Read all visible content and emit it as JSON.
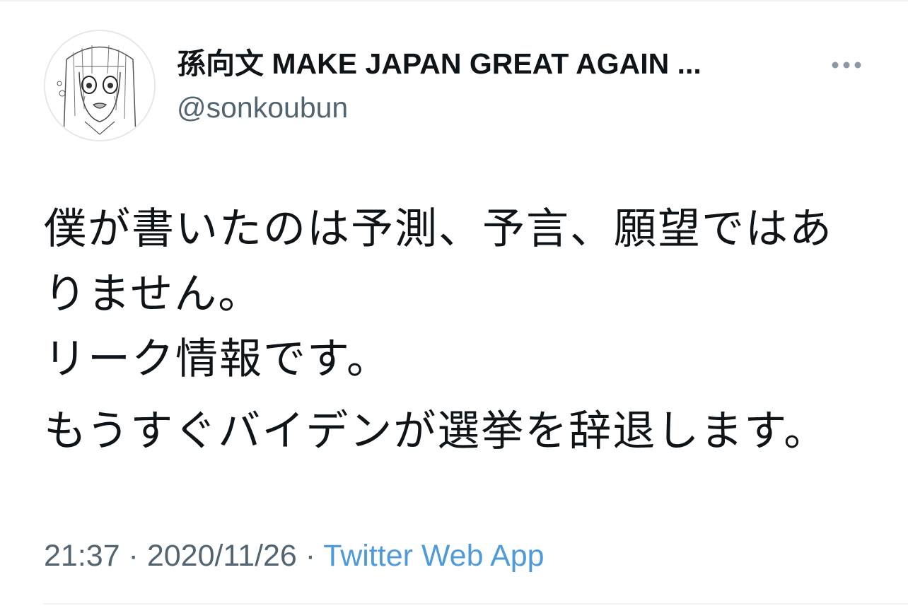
{
  "tweet": {
    "author": {
      "display_name": "孫向文  MAKE JAPAN GREAT AGAIN ...",
      "handle": "@sonkoubun"
    },
    "text": {
      "line1": "僕が書いたのは予測、予言、願望ではあ",
      "line2": "りません。",
      "line3": "リーク情報です。",
      "line4": "もうすぐバイデンが選挙を辞退します。"
    },
    "meta": {
      "time": "21:37",
      "separator": " · ",
      "date": "2020/11/26",
      "source": "Twitter Web App"
    }
  },
  "icons": {
    "avatar": "avatar-illustration",
    "more": "more-dots-icon",
    "brand": "apple-icon"
  },
  "colors": {
    "text_primary": "#0f1419",
    "text_secondary": "#536471",
    "link": "#4f9ad8"
  }
}
